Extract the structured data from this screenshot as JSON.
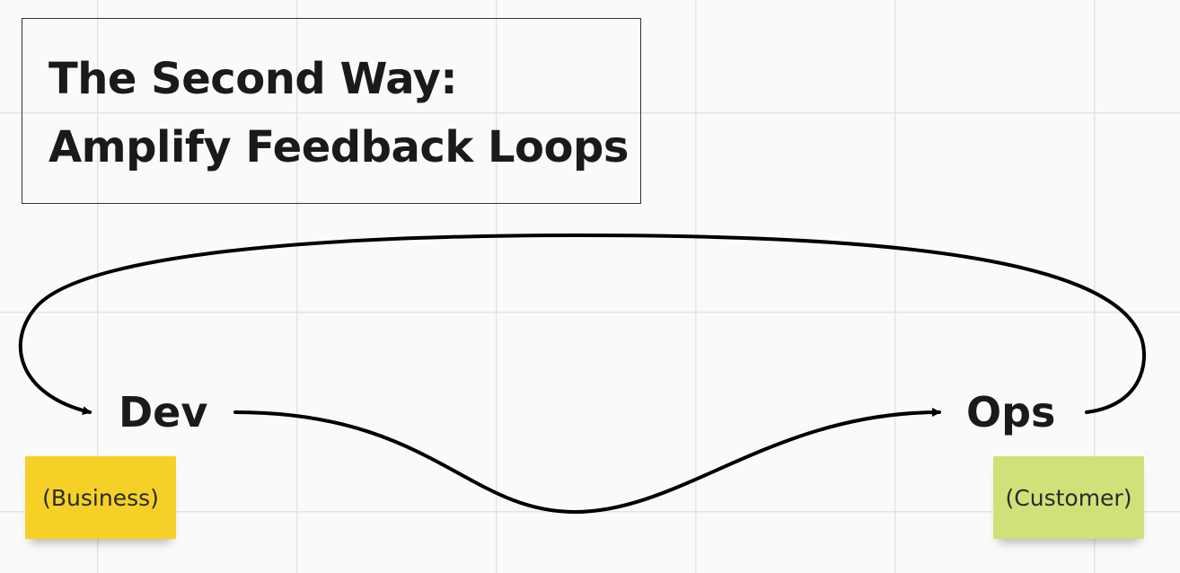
{
  "title": {
    "line1": "The Second Way:",
    "line2": "Amplify Feedback Loops"
  },
  "nodes": {
    "dev": "Dev",
    "ops": "Ops"
  },
  "sticky_notes": {
    "business": {
      "text": "(Business)",
      "color": "#f5d128"
    },
    "customer": {
      "text": "(Customer)",
      "color": "#d0e17a"
    }
  },
  "connectors": [
    {
      "from": "Dev",
      "to": "Ops",
      "style": "curved-arrow"
    },
    {
      "from": "Ops",
      "to": "Dev",
      "style": "curved-arrow-feedback"
    }
  ],
  "colors": {
    "background": "#fafafa",
    "grid": "#e4e4e4",
    "stroke": "#000000"
  }
}
